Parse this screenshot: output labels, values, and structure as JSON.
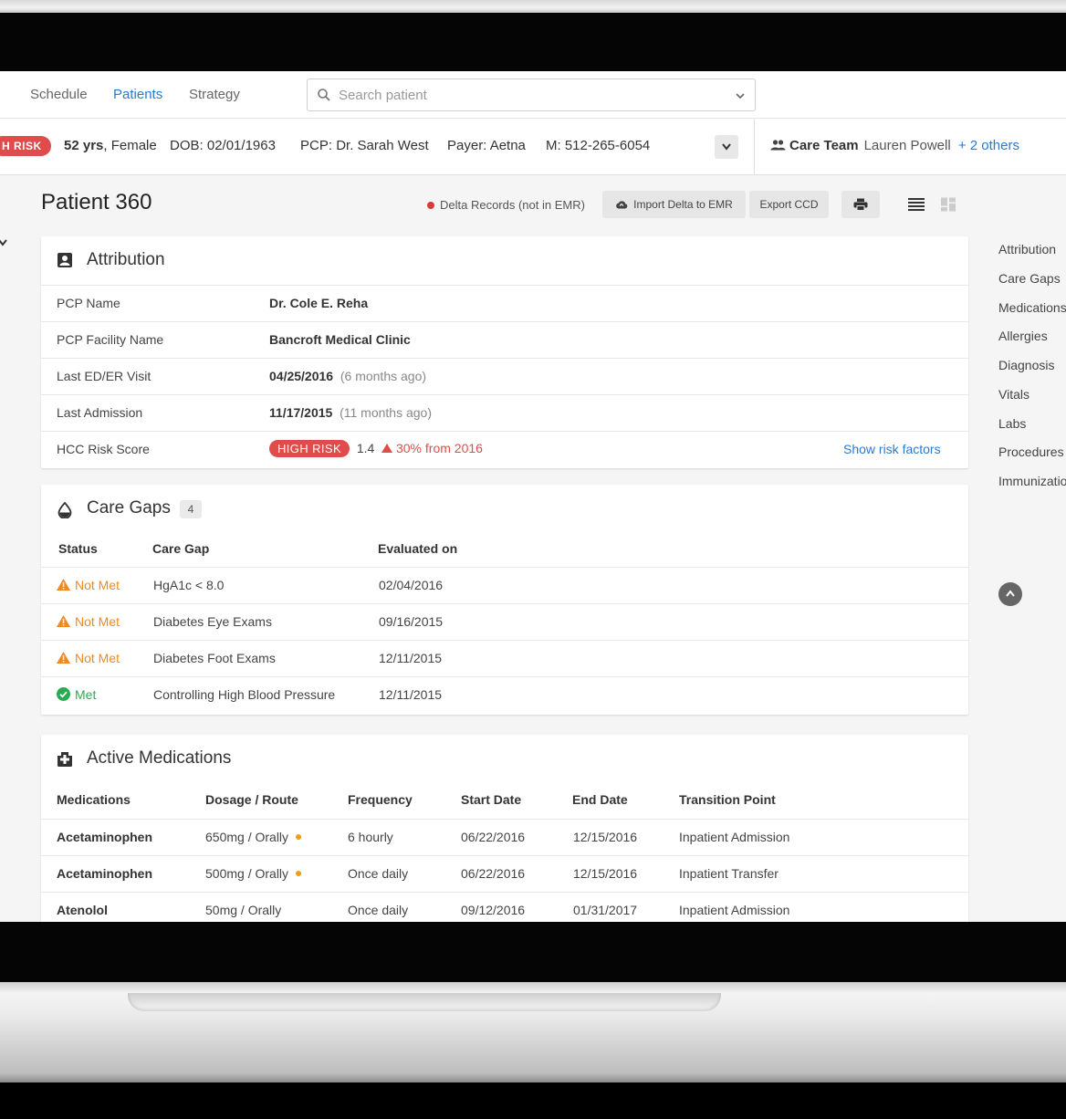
{
  "nav": {
    "items": [
      "Schedule",
      "Patients",
      "Strategy"
    ],
    "active": "Patients",
    "search_placeholder": "Search patient"
  },
  "patient_bar": {
    "risk_tag": "H RISK",
    "age_label": "52 yrs",
    "gender": "Female",
    "dob_label": "DOB:",
    "dob": "02/01/1963",
    "pcp_label": "PCP:",
    "pcp": "Dr. Sarah West",
    "payer_label": "Payer:",
    "payer": "Aetna",
    "mobile_label": "M:",
    "mobile": "512-265-6054",
    "care_team_label": "Care Team",
    "care_team_member": "Lauren Powell",
    "care_team_more": "+ 2 others"
  },
  "page": {
    "title": "Patient 360",
    "delta_label": "Delta Records (not in EMR)",
    "import_button": "Import Delta to EMR",
    "export_button": "Export CCD"
  },
  "attribution": {
    "title": "Attribution",
    "rows": [
      {
        "label": "PCP Name",
        "value": "Dr. Cole E. Reha",
        "note": ""
      },
      {
        "label": "PCP Facility Name",
        "value": "Bancroft Medical Clinic",
        "note": ""
      },
      {
        "label": "Last ED/ER Visit",
        "value": "04/25/2016",
        "note": "(6 months ago)"
      },
      {
        "label": "Last Admission",
        "value": "11/17/2015",
        "note": "(11 months ago)"
      }
    ],
    "risk": {
      "label": "HCC Risk Score",
      "badge": "HIGH RISK",
      "score": "1.4",
      "change": "30% from 2016",
      "link": "Show risk factors"
    }
  },
  "care_gaps": {
    "title": "Care Gaps",
    "count": "4",
    "headers": [
      "Status",
      "Care Gap",
      "Evaluated on"
    ],
    "rows": [
      {
        "status": "Not Met",
        "gap": "HgA1c  < 8.0",
        "date": "02/04/2016"
      },
      {
        "status": "Not Met",
        "gap": "Diabetes Eye Exams",
        "date": "09/16/2015"
      },
      {
        "status": "Not Met",
        "gap": "Diabetes Foot Exams",
        "date": "12/11/2015"
      },
      {
        "status": "Met",
        "gap": "Controlling High Blood Pressure",
        "date": "12/11/2015"
      }
    ]
  },
  "medications": {
    "title": "Active Medications",
    "headers": [
      "Medications",
      "Dosage / Route",
      "Frequency",
      "Start Date",
      "End Date",
      "Transition Point"
    ],
    "rows": [
      {
        "name": "Acetaminophen",
        "dosage": "650mg / Orally",
        "frequency": "6 hourly",
        "start": "06/22/2016",
        "end": "12/15/2016",
        "transition": "Inpatient Admission"
      },
      {
        "name": "Acetaminophen",
        "dosage": "500mg / Orally",
        "frequency": "Once daily",
        "start": "06/22/2016",
        "end": "12/15/2016",
        "transition": "Inpatient Transfer"
      },
      {
        "name": "Atenolol",
        "dosage": "50mg / Orally",
        "frequency": "Once daily",
        "start": "09/12/2016",
        "end": "01/31/2017",
        "transition": "Inpatient Admission"
      }
    ]
  },
  "rail": {
    "items": [
      "Attribution",
      "Care Gaps",
      "Medications",
      "Allergies",
      "Diagnosis",
      "Vitals",
      "Labs",
      "Procedures",
      "Immunizations"
    ]
  },
  "colors": {
    "accent": "#2a7ad1",
    "high_risk": "#e04b4b",
    "warning": "#ef8a23",
    "success": "#2bab4f"
  }
}
